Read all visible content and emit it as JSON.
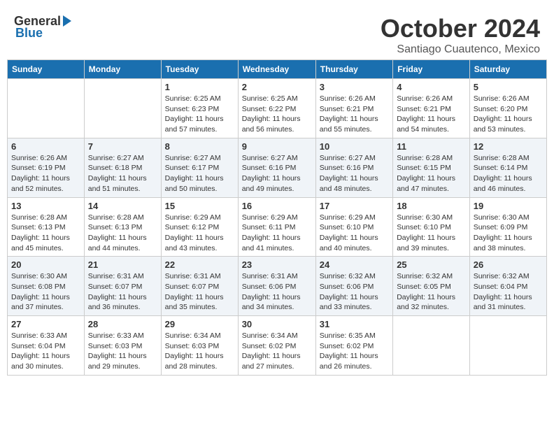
{
  "logo": {
    "general": "General",
    "blue": "Blue"
  },
  "title": {
    "month": "October 2024",
    "location": "Santiago Cuautenco, Mexico"
  },
  "headers": [
    "Sunday",
    "Monday",
    "Tuesday",
    "Wednesday",
    "Thursday",
    "Friday",
    "Saturday"
  ],
  "weeks": [
    [
      {
        "day": "",
        "info": ""
      },
      {
        "day": "",
        "info": ""
      },
      {
        "day": "1",
        "info": "Sunrise: 6:25 AM\nSunset: 6:23 PM\nDaylight: 11 hours and 57 minutes."
      },
      {
        "day": "2",
        "info": "Sunrise: 6:25 AM\nSunset: 6:22 PM\nDaylight: 11 hours and 56 minutes."
      },
      {
        "day": "3",
        "info": "Sunrise: 6:26 AM\nSunset: 6:21 PM\nDaylight: 11 hours and 55 minutes."
      },
      {
        "day": "4",
        "info": "Sunrise: 6:26 AM\nSunset: 6:21 PM\nDaylight: 11 hours and 54 minutes."
      },
      {
        "day": "5",
        "info": "Sunrise: 6:26 AM\nSunset: 6:20 PM\nDaylight: 11 hours and 53 minutes."
      }
    ],
    [
      {
        "day": "6",
        "info": "Sunrise: 6:26 AM\nSunset: 6:19 PM\nDaylight: 11 hours and 52 minutes."
      },
      {
        "day": "7",
        "info": "Sunrise: 6:27 AM\nSunset: 6:18 PM\nDaylight: 11 hours and 51 minutes."
      },
      {
        "day": "8",
        "info": "Sunrise: 6:27 AM\nSunset: 6:17 PM\nDaylight: 11 hours and 50 minutes."
      },
      {
        "day": "9",
        "info": "Sunrise: 6:27 AM\nSunset: 6:16 PM\nDaylight: 11 hours and 49 minutes."
      },
      {
        "day": "10",
        "info": "Sunrise: 6:27 AM\nSunset: 6:16 PM\nDaylight: 11 hours and 48 minutes."
      },
      {
        "day": "11",
        "info": "Sunrise: 6:28 AM\nSunset: 6:15 PM\nDaylight: 11 hours and 47 minutes."
      },
      {
        "day": "12",
        "info": "Sunrise: 6:28 AM\nSunset: 6:14 PM\nDaylight: 11 hours and 46 minutes."
      }
    ],
    [
      {
        "day": "13",
        "info": "Sunrise: 6:28 AM\nSunset: 6:13 PM\nDaylight: 11 hours and 45 minutes."
      },
      {
        "day": "14",
        "info": "Sunrise: 6:28 AM\nSunset: 6:13 PM\nDaylight: 11 hours and 44 minutes."
      },
      {
        "day": "15",
        "info": "Sunrise: 6:29 AM\nSunset: 6:12 PM\nDaylight: 11 hours and 43 minutes."
      },
      {
        "day": "16",
        "info": "Sunrise: 6:29 AM\nSunset: 6:11 PM\nDaylight: 11 hours and 41 minutes."
      },
      {
        "day": "17",
        "info": "Sunrise: 6:29 AM\nSunset: 6:10 PM\nDaylight: 11 hours and 40 minutes."
      },
      {
        "day": "18",
        "info": "Sunrise: 6:30 AM\nSunset: 6:10 PM\nDaylight: 11 hours and 39 minutes."
      },
      {
        "day": "19",
        "info": "Sunrise: 6:30 AM\nSunset: 6:09 PM\nDaylight: 11 hours and 38 minutes."
      }
    ],
    [
      {
        "day": "20",
        "info": "Sunrise: 6:30 AM\nSunset: 6:08 PM\nDaylight: 11 hours and 37 minutes."
      },
      {
        "day": "21",
        "info": "Sunrise: 6:31 AM\nSunset: 6:07 PM\nDaylight: 11 hours and 36 minutes."
      },
      {
        "day": "22",
        "info": "Sunrise: 6:31 AM\nSunset: 6:07 PM\nDaylight: 11 hours and 35 minutes."
      },
      {
        "day": "23",
        "info": "Sunrise: 6:31 AM\nSunset: 6:06 PM\nDaylight: 11 hours and 34 minutes."
      },
      {
        "day": "24",
        "info": "Sunrise: 6:32 AM\nSunset: 6:06 PM\nDaylight: 11 hours and 33 minutes."
      },
      {
        "day": "25",
        "info": "Sunrise: 6:32 AM\nSunset: 6:05 PM\nDaylight: 11 hours and 32 minutes."
      },
      {
        "day": "26",
        "info": "Sunrise: 6:32 AM\nSunset: 6:04 PM\nDaylight: 11 hours and 31 minutes."
      }
    ],
    [
      {
        "day": "27",
        "info": "Sunrise: 6:33 AM\nSunset: 6:04 PM\nDaylight: 11 hours and 30 minutes."
      },
      {
        "day": "28",
        "info": "Sunrise: 6:33 AM\nSunset: 6:03 PM\nDaylight: 11 hours and 29 minutes."
      },
      {
        "day": "29",
        "info": "Sunrise: 6:34 AM\nSunset: 6:03 PM\nDaylight: 11 hours and 28 minutes."
      },
      {
        "day": "30",
        "info": "Sunrise: 6:34 AM\nSunset: 6:02 PM\nDaylight: 11 hours and 27 minutes."
      },
      {
        "day": "31",
        "info": "Sunrise: 6:35 AM\nSunset: 6:02 PM\nDaylight: 11 hours and 26 minutes."
      },
      {
        "day": "",
        "info": ""
      },
      {
        "day": "",
        "info": ""
      }
    ]
  ]
}
